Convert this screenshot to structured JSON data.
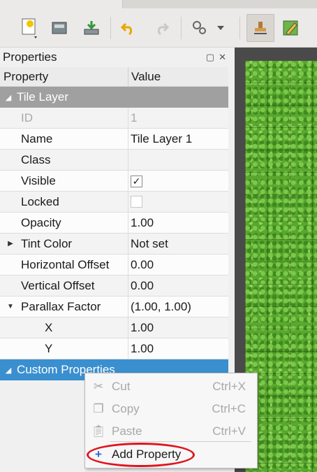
{
  "toolbar": {
    "buttons": [
      "new-icon",
      "open-icon",
      "save-icon",
      "undo-icon",
      "redo-icon",
      "tools-icon",
      "stamp-icon",
      "edit-icon"
    ]
  },
  "panel": {
    "title": "Properties",
    "header": {
      "property": "Property",
      "value": "Value"
    },
    "group": "Tile Layer",
    "rows": {
      "id": {
        "key": "ID",
        "value": "1"
      },
      "name": {
        "key": "Name",
        "value": "Tile Layer 1"
      },
      "class": {
        "key": "Class",
        "value": ""
      },
      "visible": {
        "key": "Visible",
        "value": "✓"
      },
      "locked": {
        "key": "Locked",
        "value": ""
      },
      "opacity": {
        "key": "Opacity",
        "value": "1.00"
      },
      "tint": {
        "key": "Tint Color",
        "value": "Not set"
      },
      "hoffset": {
        "key": "Horizontal Offset",
        "value": "0.00"
      },
      "voffset": {
        "key": "Vertical Offset",
        "value": "0.00"
      },
      "parallax": {
        "key": "Parallax Factor",
        "value": "(1.00, 1.00)"
      },
      "px": {
        "key": "X",
        "value": "1.00"
      },
      "py": {
        "key": "Y",
        "value": "1.00"
      }
    },
    "custom": "Custom Properties"
  },
  "menu": {
    "cut": {
      "label": "Cut",
      "shortcut": "Ctrl+X"
    },
    "copy": {
      "label": "Copy",
      "shortcut": "Ctrl+C"
    },
    "paste": {
      "label": "Paste",
      "shortcut": "Ctrl+V"
    },
    "add": {
      "label": "Add Property"
    }
  },
  "colors": {
    "accent": "#3a8fcf",
    "highlight": "#e0141e",
    "group": "#a0a0a0"
  }
}
